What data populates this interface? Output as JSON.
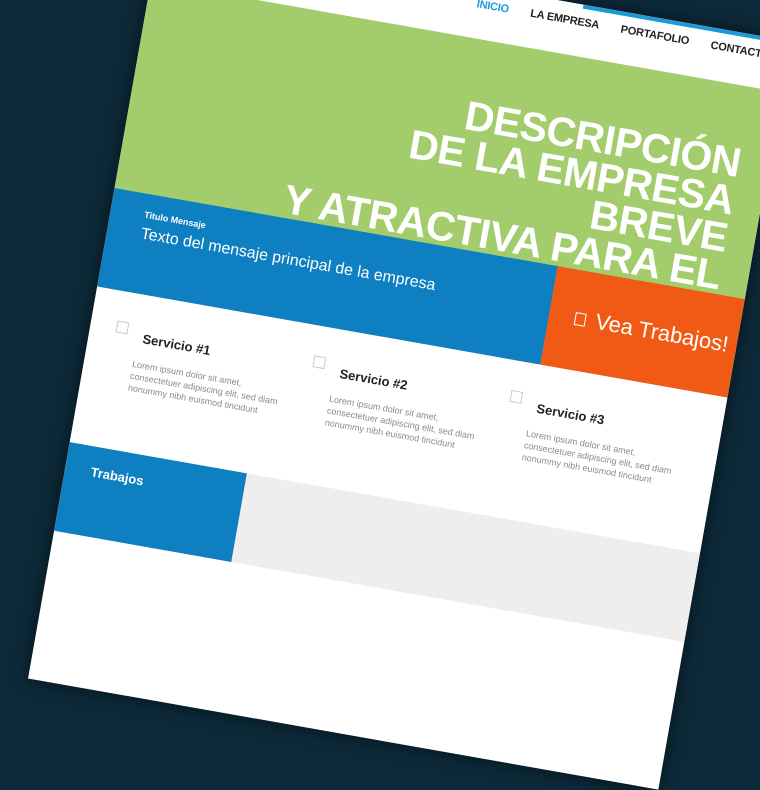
{
  "nav": {
    "items": [
      "INICIO",
      "LA EMPRESA",
      "PORTAFOLIO",
      "CONTACTO"
    ],
    "active": "INICIO"
  },
  "hero": {
    "headline": "DESCRIPCIÓN\nDE LA EMPRESA\nBREVE\nY ATRACTIVA PARA EL\nCLIENTE."
  },
  "message": {
    "title": "Titulo Mensaje",
    "text": "Texto del mensaje principal de la empresa"
  },
  "cta": {
    "label": "Vea Trabajos!",
    "icon": "box-icon"
  },
  "services": [
    {
      "title": "Servicio #1",
      "text": "Lorem ipsum dolor sit amet, consectetuer adipiscing elit, sed diam nonummy nibh euismod tincidunt"
    },
    {
      "title": "Servicio #2",
      "text": "Lorem ipsum dolor sit amet, consectetuer adipiscing elit, sed diam nonummy nibh euismod tincidunt"
    },
    {
      "title": "Servicio #3",
      "text": "Lorem ipsum dolor sit amet, consectetuer adipiscing elit, sed diam nonummy nibh euismod tincidunt"
    }
  ],
  "bottom": {
    "label": "Trabajos"
  },
  "colors": {
    "hero": "#a3cd6d",
    "message_band": "#0e7fc0",
    "cta": "#f05a14",
    "nav_active": "#1a9bd7",
    "background": "#0d2a3a"
  }
}
